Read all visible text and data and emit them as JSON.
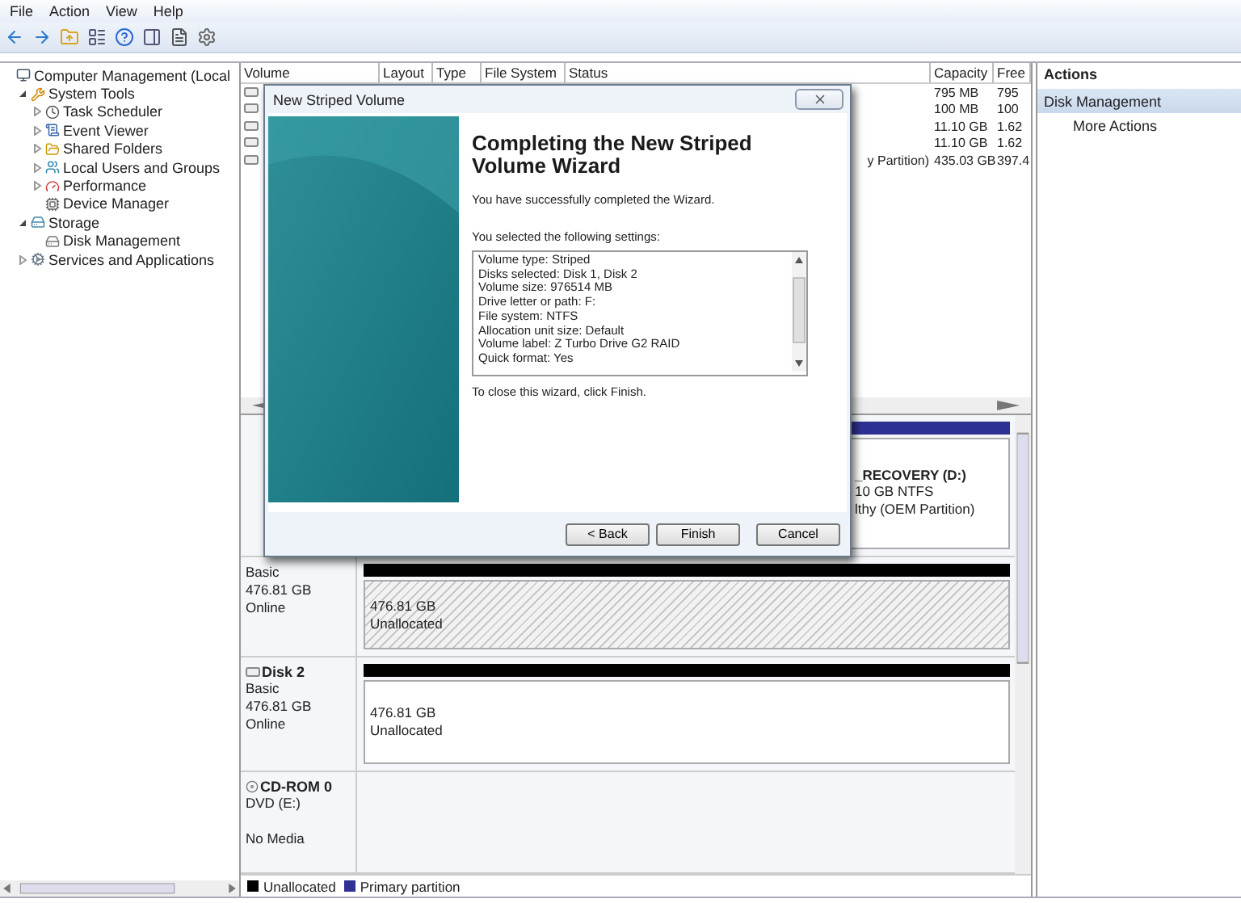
{
  "menu": [
    "File",
    "Action",
    "View",
    "Help"
  ],
  "tree": [
    {
      "label": "Computer Management (Local",
      "children": [
        {
          "label": "System Tools",
          "expanded": true,
          "children": [
            {
              "label": "Task Scheduler",
              "expanded": false
            },
            {
              "label": "Event Viewer",
              "expanded": false
            },
            {
              "label": "Shared Folders",
              "expanded": false
            },
            {
              "label": "Local Users and Groups",
              "expanded": false
            },
            {
              "label": "Performance",
              "expanded": false
            },
            {
              "label": "Device Manager"
            }
          ]
        },
        {
          "label": "Storage",
          "expanded": true,
          "children": [
            {
              "label": "Disk Management"
            }
          ]
        },
        {
          "label": "Services and Applications",
          "expanded": false
        }
      ]
    }
  ],
  "volume_list": {
    "columns": [
      "Volume",
      "Layout",
      "Type",
      "File System",
      "Status",
      "Capacity",
      "Free"
    ],
    "rows": [
      {
        "capacity": "795 MB",
        "free": "795"
      },
      {
        "capacity": "100 MB",
        "free": "100"
      },
      {
        "capacity": "11.10 GB",
        "free": "1.62"
      },
      {
        "capacity": "11.10 GB",
        "free": "1.62"
      },
      {
        "status": "y Partition)",
        "capacity": "435.03 GB",
        "free": "397.4"
      }
    ]
  },
  "disks": [
    {
      "partitions": [
        {
          "kind": "primary",
          "selected": false,
          "title": "_RECOVERY  (D:)",
          "lines": [
            "10 GB NTFS",
            "lthy (OEM Partition)"
          ]
        }
      ]
    },
    {
      "lines": [
        "Basic",
        "476.81 GB",
        "Online"
      ],
      "partitions": [
        {
          "kind": "unallocated",
          "selected": true,
          "lines": [
            "476.81 GB",
            "Unallocated"
          ]
        }
      ]
    },
    {
      "name": "Disk 2",
      "lines": [
        "Basic",
        "476.81 GB",
        "Online"
      ],
      "partitions": [
        {
          "kind": "unallocated",
          "selected": false,
          "lines": [
            "476.81 GB",
            "Unallocated"
          ]
        }
      ]
    },
    {
      "name": "CD-ROM 0",
      "kind": "cdrom",
      "lines": [
        "DVD (E:)",
        "No Media"
      ]
    }
  ],
  "legend": [
    {
      "label": "Unallocated",
      "color": "#000000"
    },
    {
      "label": "Primary partition",
      "color": "#2e3192"
    }
  ],
  "actions": {
    "title": "Actions",
    "items": [
      {
        "label": "Disk Management",
        "selected": true
      },
      {
        "label": "More Actions",
        "selected": false
      }
    ]
  },
  "dialog": {
    "title": "New Striped Volume",
    "heading": "Completing the New Striped Volume Wizard",
    "intro": "You have successfully completed the Wizard.",
    "settings_label": "You selected the following settings:",
    "settings": [
      "Volume type: Striped",
      "Disks selected: Disk 1, Disk 2",
      "Volume size: 976514 MB",
      "Drive letter or path: F:",
      "File system: NTFS",
      "Allocation unit size: Default",
      "Volume label: Z Turbo Drive G2 RAID",
      "Quick format: Yes"
    ],
    "closing": "To close this wizard, click Finish.",
    "buttons": [
      "< Back",
      "Finish",
      "Cancel"
    ]
  }
}
